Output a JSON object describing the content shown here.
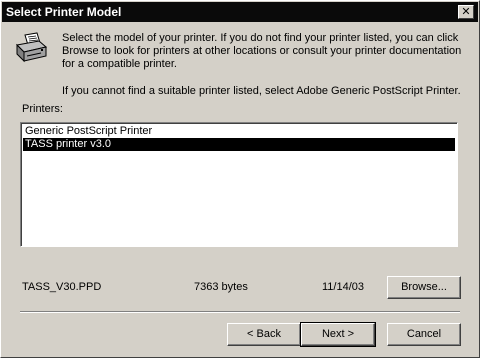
{
  "window": {
    "title": "Select Printer Model",
    "close_glyph": "✕"
  },
  "description": {
    "paragraph1": "Select the model of your printer. If you do not find your printer listed, you can click Browse to look for printers at other locations or consult your printer documentation for a compatible printer.",
    "paragraph2": "If you cannot find a suitable printer listed, select Adobe Generic PostScript Printer."
  },
  "printers": {
    "label": "Printers:",
    "items": [
      {
        "label": "Generic PostScript Printer",
        "selected": false
      },
      {
        "label": "TASS printer v3.0",
        "selected": true
      }
    ]
  },
  "file_info": {
    "filename": "TASS_V30.PPD",
    "size": "7363 bytes",
    "date": "11/14/03"
  },
  "buttons": {
    "browse": "Browse...",
    "back": "< Back",
    "next": "Next >",
    "cancel": "Cancel"
  },
  "icons": {
    "printer": "printer-icon"
  }
}
